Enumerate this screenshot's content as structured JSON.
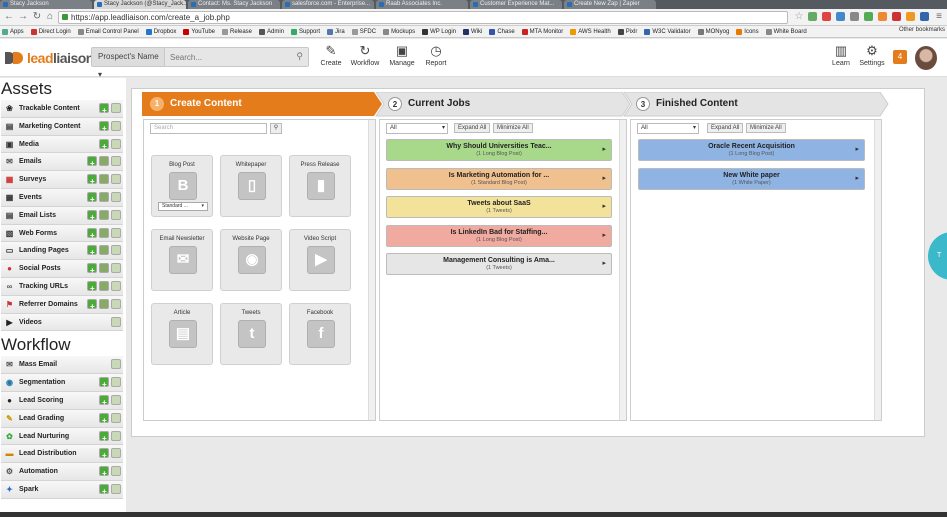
{
  "browser": {
    "tabs": [
      "Stacy Jackson",
      "Stacy Jackson (@Stacy_Jack...",
      "Contact: Ms. Stacy Jackson",
      "salesforce.com - Enterprise...",
      "Raab Associates Inc.",
      "Customer Experience Mat...",
      "Create New Zap | Zapier"
    ],
    "url": "https://app.leadliaison.com/create_a_job.php",
    "bookmarks": [
      "Apps",
      "Direct Login",
      "Email Control Panel",
      "Dropbox",
      "YouTube",
      "Release",
      "Admin",
      "Support",
      "Jira",
      "SFDC",
      "Mockups",
      "WP Login",
      "Wiki",
      "Chase",
      "MTA Monitor",
      "AWS Health",
      "Pixlr",
      "W3C Validator",
      "MONyog",
      "Icons",
      "White Board"
    ],
    "other_bookmarks": "Other bookmarks"
  },
  "header": {
    "logo_a": "lead",
    "logo_b": "liaison",
    "prospect_select": "Prospect's Name",
    "search_placeholder": "Search...",
    "actions": {
      "create": "Create",
      "workflow": "Workflow",
      "manage": "Manage",
      "report": "Report",
      "learn": "Learn",
      "settings": "Settings"
    },
    "badge_count": "4"
  },
  "sidebar": {
    "assets_title": "Assets",
    "assets": [
      {
        "label": "Trackable Content",
        "icon": "paw-icon"
      },
      {
        "label": "Marketing Content",
        "icon": "folder-icon"
      },
      {
        "label": "Media",
        "icon": "image-icon"
      },
      {
        "label": "Emails",
        "icon": "email-icon"
      },
      {
        "label": "Surveys",
        "icon": "survey-icon"
      },
      {
        "label": "Events",
        "icon": "calendar-icon"
      },
      {
        "label": "Email Lists",
        "icon": "list-icon"
      },
      {
        "label": "Web Forms",
        "icon": "form-icon"
      },
      {
        "label": "Landing Pages",
        "icon": "page-icon"
      },
      {
        "label": "Social Posts",
        "icon": "pin-icon"
      },
      {
        "label": "Tracking URLs",
        "icon": "link-icon"
      },
      {
        "label": "Referrer Domains",
        "icon": "flag-icon"
      },
      {
        "label": "Videos",
        "icon": "play-icon"
      }
    ],
    "workflow_title": "Workflow",
    "workflow": [
      {
        "label": "Mass Email",
        "icon": "email-icon"
      },
      {
        "label": "Segmentation",
        "icon": "globe-icon"
      },
      {
        "label": "Lead Scoring",
        "icon": "disk-icon"
      },
      {
        "label": "Lead Grading",
        "icon": "pencil-icon"
      },
      {
        "label": "Lead Nurturing",
        "icon": "plant-icon"
      },
      {
        "label": "Lead Distribution",
        "icon": "stack-icon"
      },
      {
        "label": "Automation",
        "icon": "gear-icon"
      },
      {
        "label": "Spark",
        "icon": "spark-icon"
      }
    ]
  },
  "stages": [
    {
      "num": "1",
      "title": "Create Content"
    },
    {
      "num": "2",
      "title": "Current Jobs"
    },
    {
      "num": "3",
      "title": "Finished Content"
    }
  ],
  "create": {
    "search_placeholder": "Search",
    "tiles": [
      {
        "title": "Blog Post",
        "glyph": "B",
        "dropdown": "Standard ..."
      },
      {
        "title": "Whitepaper",
        "glyph": "▯"
      },
      {
        "title": "Press Release",
        "glyph": "▮"
      },
      {
        "title": "Email Newsletter",
        "glyph": "✉"
      },
      {
        "title": "Website Page",
        "glyph": "◉"
      },
      {
        "title": "Video Script",
        "glyph": "▶"
      },
      {
        "title": "Article",
        "glyph": "▤"
      },
      {
        "title": "Tweets",
        "glyph": "t"
      },
      {
        "title": "Facebook",
        "glyph": "f"
      }
    ]
  },
  "current": {
    "filter": "All",
    "expand": "Expand All",
    "minimize": "Minimize All",
    "jobs": [
      {
        "title": "Why Should Universities Teac...",
        "sub": "(1 Long Blog Post)",
        "color": "#a8d98a"
      },
      {
        "title": "Is Marketing Automation for ...",
        "sub": "(1 Standard Blog Post)",
        "color": "#f0c08f"
      },
      {
        "title": "Tweets about SaaS",
        "sub": "(1 Tweets)",
        "color": "#f3e39a"
      },
      {
        "title": "Is LinkedIn Bad for Staffing...",
        "sub": "(1 Long Blog Post)",
        "color": "#f0aaa0"
      },
      {
        "title": "Management Consulting is Ama...",
        "sub": "(1 Tweets)",
        "color": "#e6e6e6"
      }
    ]
  },
  "finished": {
    "filter": "All",
    "expand": "Expand All",
    "minimize": "Minimize All",
    "jobs": [
      {
        "title": "Oracle Recent Acquisition",
        "sub": "(1 Long Blog Post)",
        "color": "#8fb4e3"
      },
      {
        "title": "New White paper",
        "sub": "(1 White Paper)",
        "color": "#8fb4e3"
      }
    ]
  },
  "colors": {
    "accent": "#e57c1c",
    "stage_grey": "#e4e4e4"
  }
}
